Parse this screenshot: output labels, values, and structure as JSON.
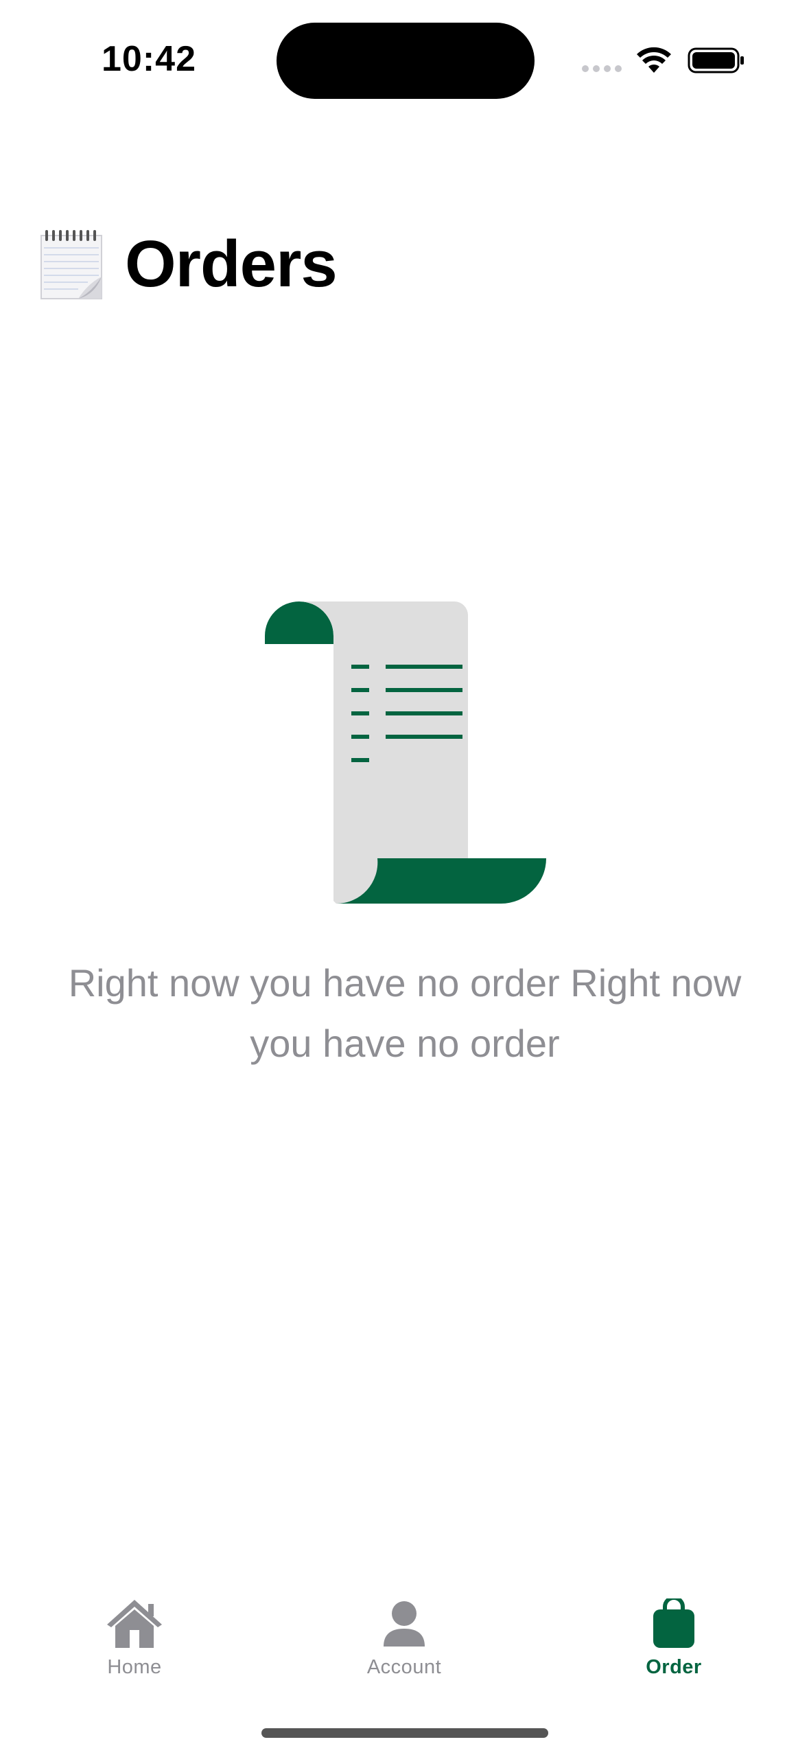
{
  "status_bar": {
    "time": "10:42"
  },
  "header": {
    "title": "Orders",
    "icon": "notepad-icon"
  },
  "empty_state": {
    "illustration": "receipt-scroll-icon",
    "message": "Right now you have no order Right now you have no order"
  },
  "tab_bar": {
    "tabs": [
      {
        "label": "Home",
        "icon": "house-icon",
        "active": false
      },
      {
        "label": "Account",
        "icon": "person-icon",
        "active": false
      },
      {
        "label": "Order",
        "icon": "bag-icon",
        "active": true
      }
    ]
  },
  "colors": {
    "accent": "#036440",
    "inactive": "#8e8e93",
    "paper": "#dedede"
  }
}
